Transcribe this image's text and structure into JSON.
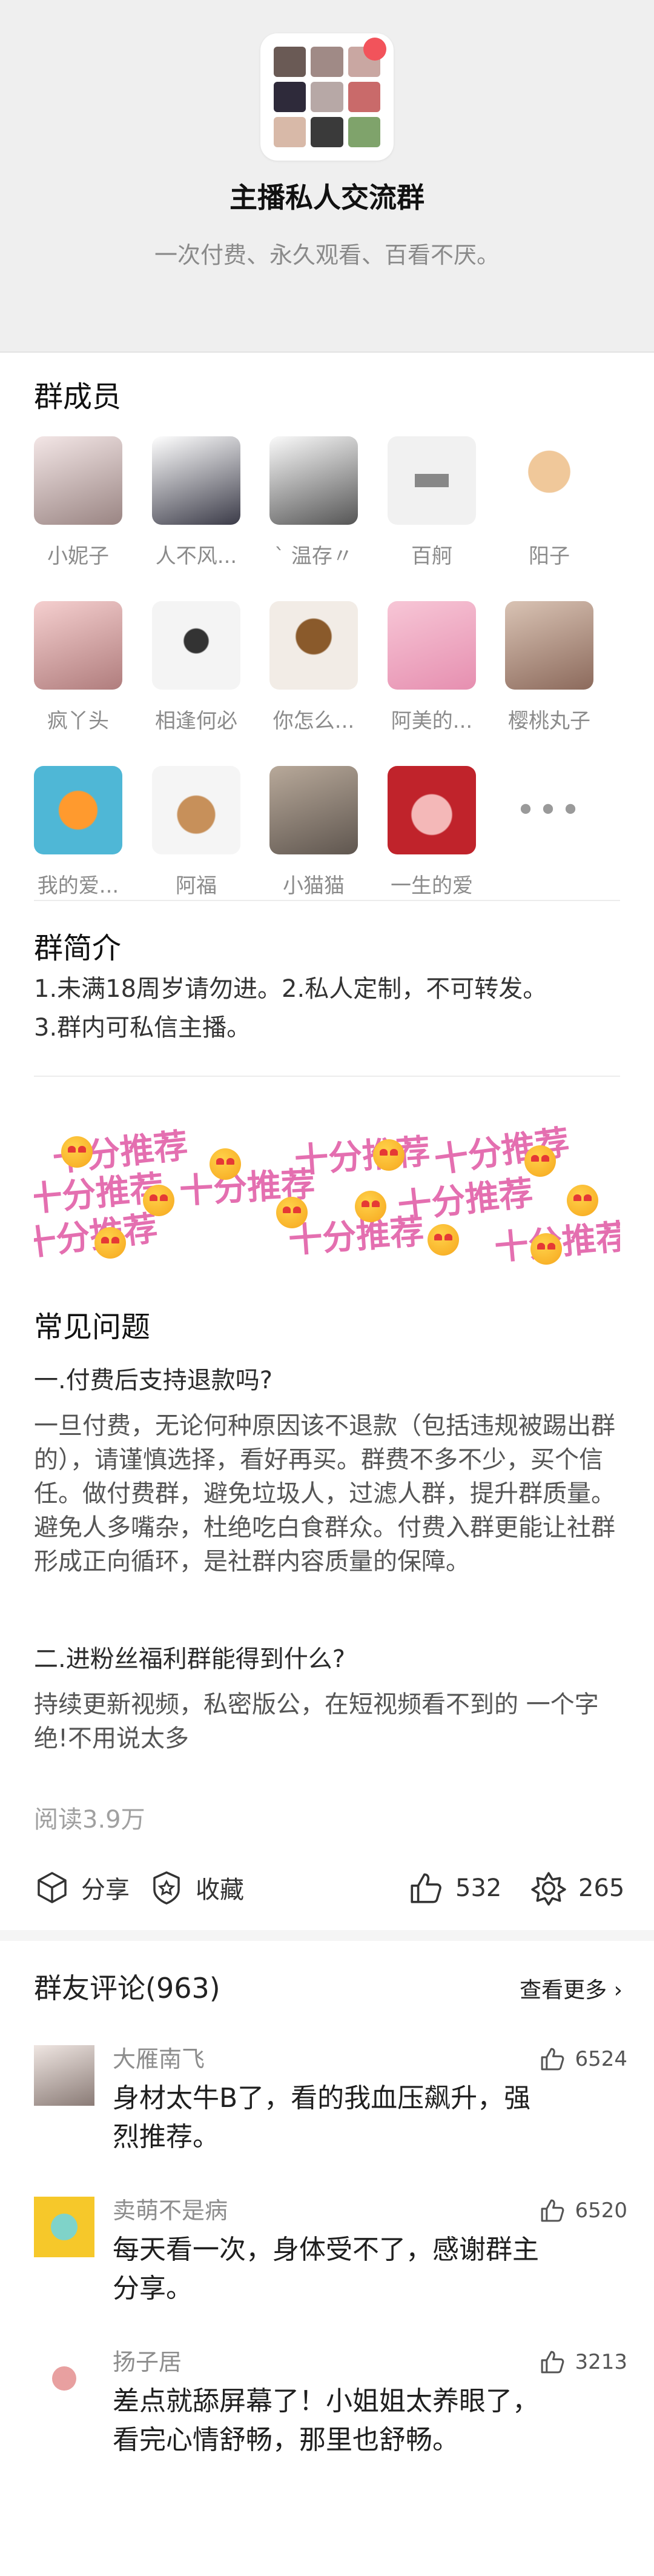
{
  "group": {
    "title": "主播私人交流群",
    "subtitle": "一次付费、永久观看、百看不厌。"
  },
  "members_section": {
    "title": "群成员",
    "members": [
      {
        "name": "小妮子"
      },
      {
        "name": "人不风..."
      },
      {
        "name": "` 温存〃"
      },
      {
        "name": "百舸"
      },
      {
        "name": "阳子"
      },
      {
        "name": "疯丫头"
      },
      {
        "name": "相逢何必"
      },
      {
        "name": "你怎么..."
      },
      {
        "name": "阿美的..."
      },
      {
        "name": "樱桃丸子"
      },
      {
        "name": "我的爱..."
      },
      {
        "name": "阿福"
      },
      {
        "name": "小猫猫"
      },
      {
        "name": "一生的爱"
      }
    ],
    "more_label": "•••"
  },
  "intro": {
    "title": "群简介",
    "lines": [
      "1.未满18周岁请勿进。2.私人定制，不可转发。",
      "3.群内可私信主播。"
    ]
  },
  "banner": {
    "text": "十分推荐"
  },
  "faq": {
    "title": "常见问题",
    "items": [
      {
        "q": "一.付费后支持退款吗?",
        "a": "一旦付费，无论何种原因该不退款（包括违规被踢出群的），请谨慎选择，看好再买。群费不多不少，买个信任。做付费群，避免垃圾人，过滤人群，提升群质量。避免人多嘴杂，杜绝吃白食群众。付费入群更能让社群形成正向循环，是社群内容质量的保障。"
      },
      {
        "q": "二.进粉丝福利群能得到什么?",
        "a": "持续更新视频，私密版公，在短视频看不到的 一个字绝!不用说太多"
      }
    ]
  },
  "reads": "阅读3.9万",
  "actions": {
    "share_label": "分享",
    "favorite_label": "收藏",
    "like_count": "532",
    "gift_count": "265"
  },
  "comments": {
    "title": "群友评论(963)",
    "see_more": "查看更多",
    "items": [
      {
        "name": "大雁南飞",
        "text": "身材太牛B了，看的我血压飙升，强烈推荐。",
        "likes": "6524"
      },
      {
        "name": "卖萌不是病",
        "text": "每天看一次，身体受不了，感谢群主分享。",
        "likes": "6520"
      },
      {
        "name": "扬子居",
        "text": "差点就舔屏幕了！小姐姐太养眼了，看完心情舒畅，那里也舒畅。",
        "likes": "3213"
      }
    ]
  },
  "colors": {
    "accent_red": "#f2535b",
    "banner_pink": "#e46fb0",
    "muted_text": "#8b8b8b"
  },
  "icons": {
    "share": "cube-icon",
    "favorite": "star-badge-icon",
    "like": "thumb-up-icon",
    "gift": "gear-flower-icon",
    "more": "ellipsis-icon"
  }
}
